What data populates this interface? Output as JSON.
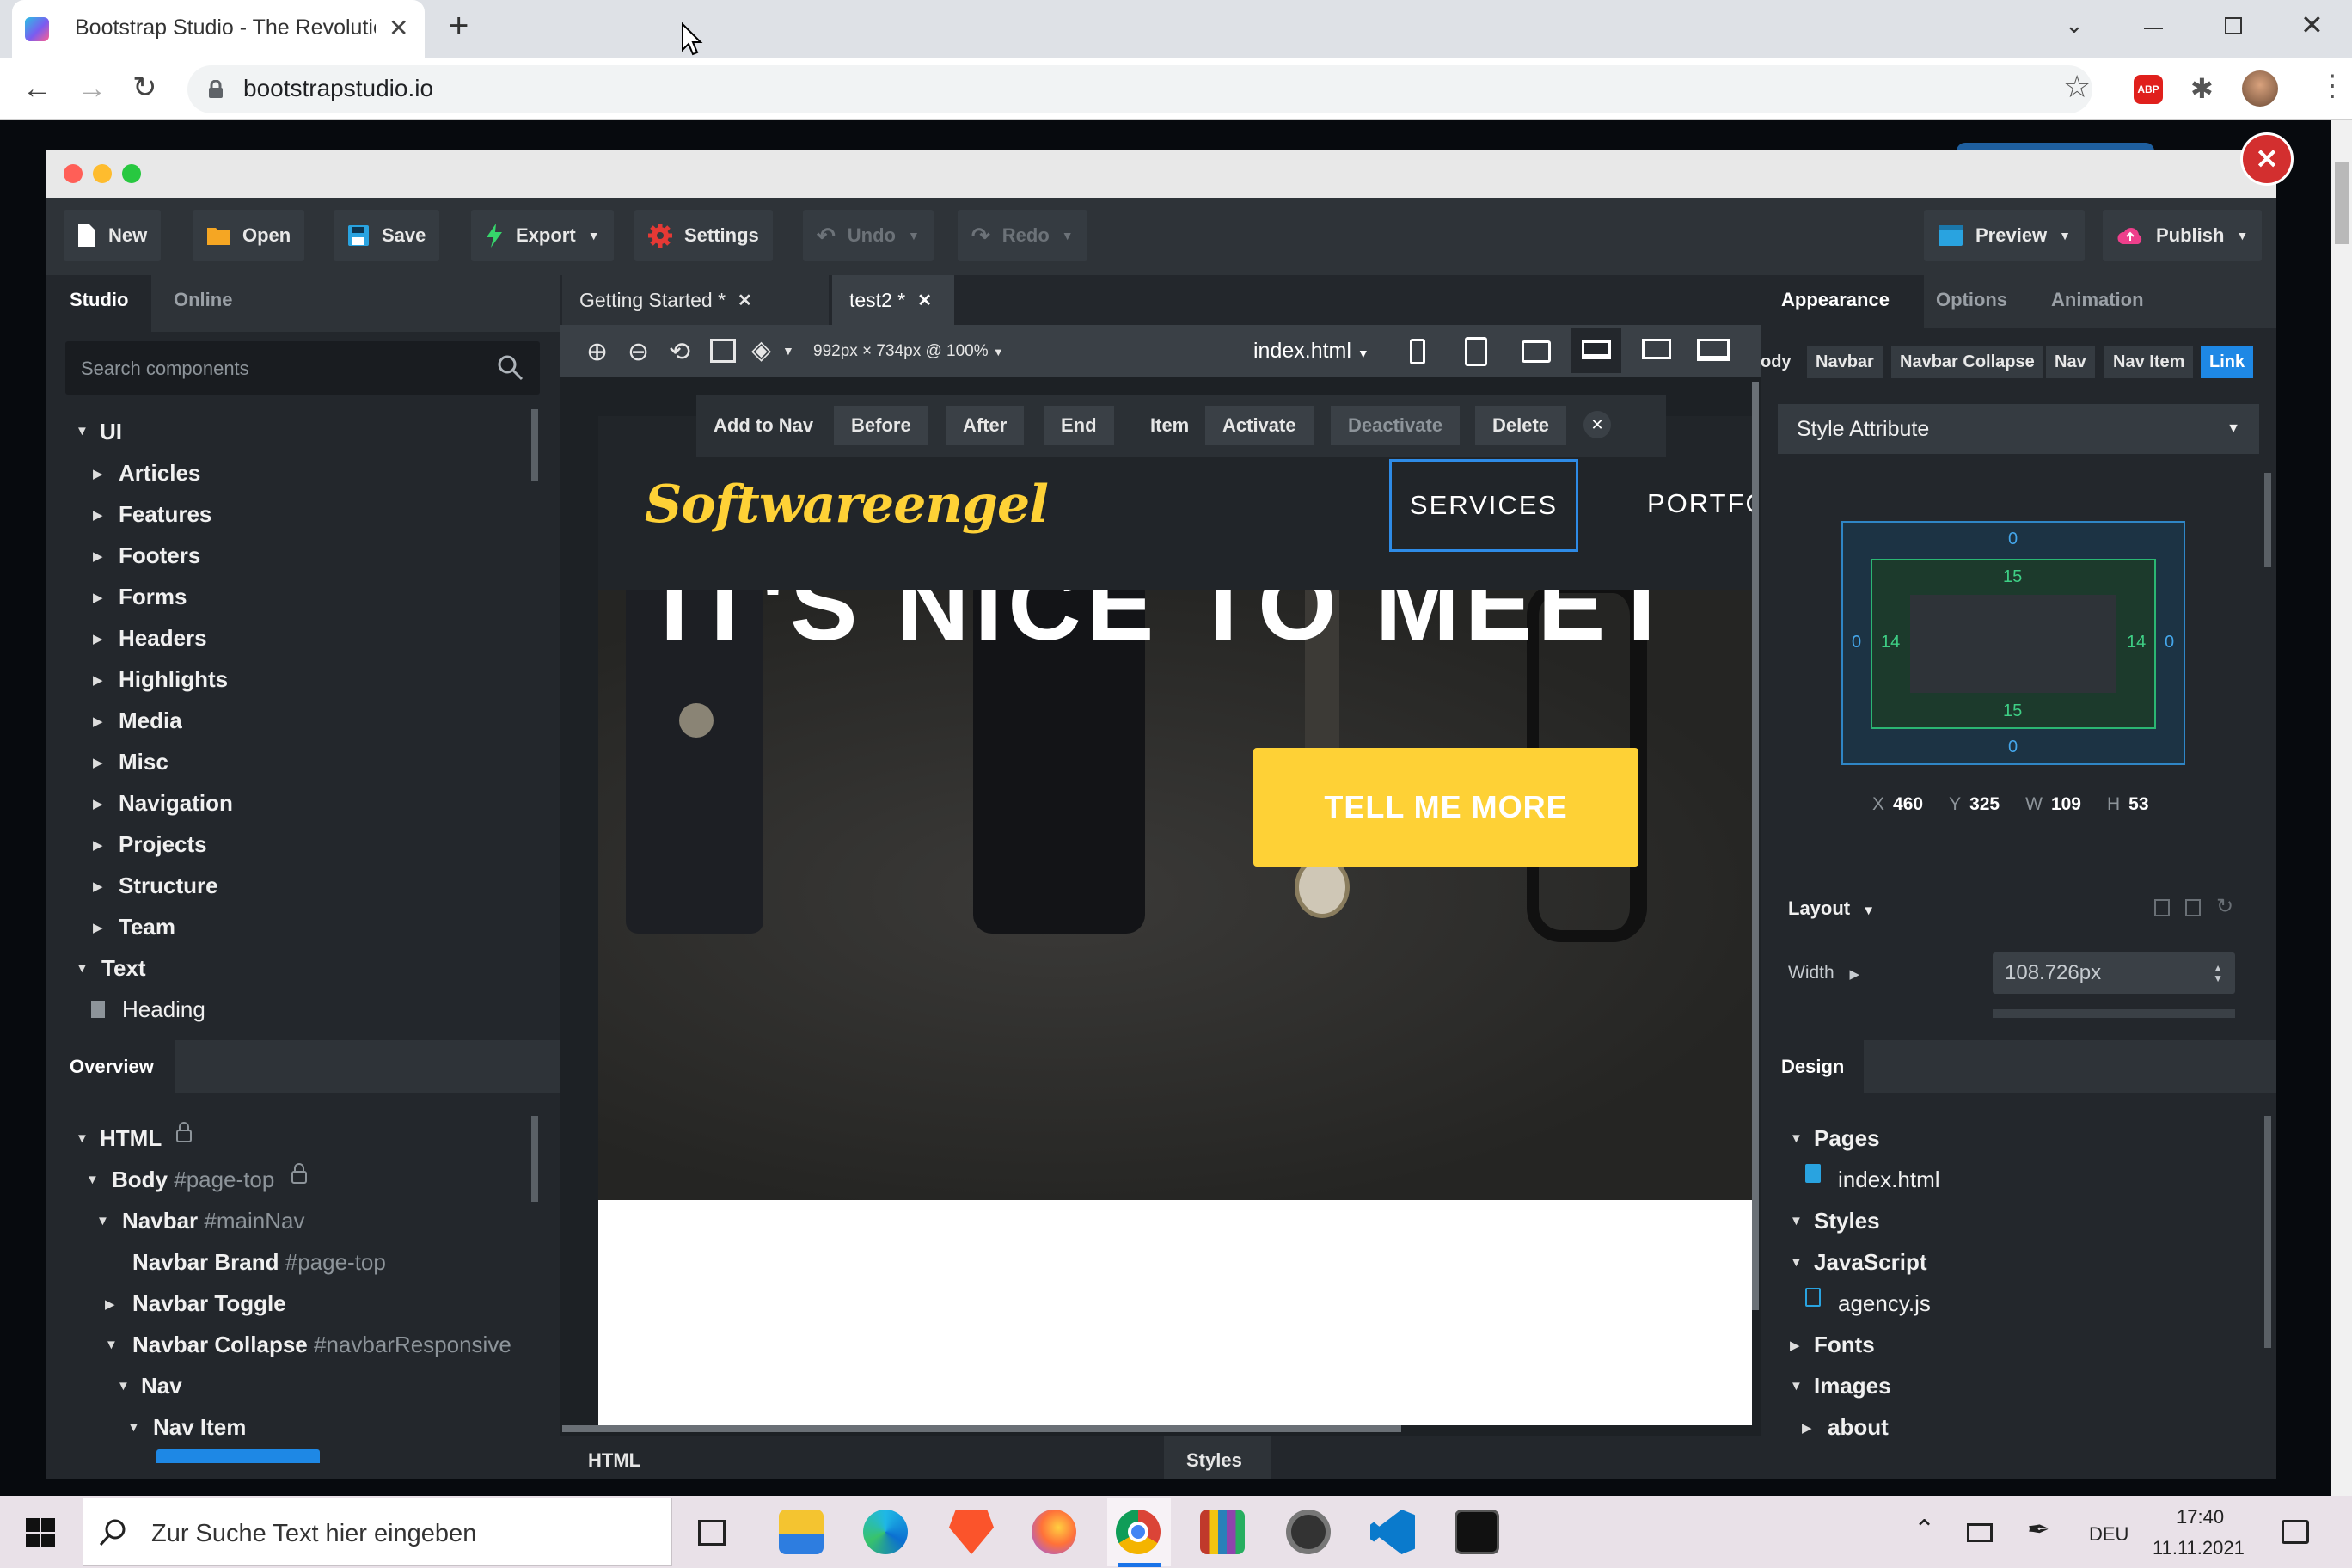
{
  "browser": {
    "tab_title": "Bootstrap Studio - The Revolutio",
    "url": "bootstrapstudio.io",
    "abp_label": "ABP"
  },
  "app": {
    "toolbar": {
      "new": "New",
      "open": "Open",
      "save": "Save",
      "export": "Export",
      "settings": "Settings",
      "undo": "Undo",
      "redo": "Redo",
      "preview": "Preview",
      "publish": "Publish"
    },
    "left": {
      "tabs": [
        "Studio",
        "Online"
      ],
      "search_placeholder": "Search components",
      "ui_root": "UI",
      "ui_items": [
        "Articles",
        "Features",
        "Footers",
        "Forms",
        "Headers",
        "Highlights",
        "Media",
        "Misc",
        "Navigation",
        "Projects",
        "Structure",
        "Team"
      ],
      "text_root": "Text",
      "text_child": "Heading",
      "overview_tab": "Overview",
      "overview": [
        {
          "label": "HTML",
          "id": ""
        },
        {
          "label": "Body",
          "id": "#page-top"
        },
        {
          "label": "Navbar",
          "id": "#mainNav"
        },
        {
          "label": "Navbar Brand",
          "id": "#page-top"
        },
        {
          "label": "Navbar Toggle",
          "id": ""
        },
        {
          "label": "Navbar Collapse",
          "id": "#navbarResponsive"
        },
        {
          "label": "Nav",
          "id": ""
        },
        {
          "label": "Nav Item",
          "id": ""
        }
      ]
    },
    "center": {
      "tabs": [
        "Getting Started *",
        "test2 *"
      ],
      "size_readout": "992px × 734px @ 100%",
      "file": "index.html",
      "context_toolbar": [
        "Add to Nav",
        "Before",
        "After",
        "End",
        "Item",
        "Activate",
        "Deactivate",
        "Delete"
      ],
      "brand": "Softwareengel",
      "nav_links": [
        "SERVICES",
        "PORTFOLIO"
      ],
      "hero_heading": "IT'S NICE TO MEET",
      "hero_button": "TELL ME MORE",
      "bottom_tabs": [
        "HTML",
        "Styles"
      ]
    },
    "right": {
      "tabs": [
        "Appearance",
        "Options",
        "Animation"
      ],
      "breadcrumb": [
        "ody",
        "Navbar",
        "Navbar Collapse",
        "Nav",
        "Nav Item",
        "Link"
      ],
      "style_select": "Style Attribute",
      "box_model": {
        "margin_top": "0",
        "margin_right": "0",
        "margin_bottom": "0",
        "margin_left": "0",
        "padding_top": "15",
        "padding_right": "14",
        "padding_bottom": "15",
        "padding_left": "14"
      },
      "metrics": {
        "x_label": "X",
        "x": "460",
        "y_label": "Y",
        "y": "325",
        "w_label": "W",
        "w": "109",
        "h_label": "H",
        "h": "53"
      },
      "layout_label": "Layout",
      "width_label": "Width",
      "width_value": "108.726px",
      "design_tab": "Design",
      "design_tree": [
        {
          "label": "Pages",
          "kind": "folder"
        },
        {
          "label": "index.html",
          "kind": "file"
        },
        {
          "label": "Styles",
          "kind": "folder"
        },
        {
          "label": "JavaScript",
          "kind": "folder"
        },
        {
          "label": "agency.js",
          "kind": "file"
        },
        {
          "label": "Fonts",
          "kind": "folder"
        },
        {
          "label": "Images",
          "kind": "folder"
        },
        {
          "label": "about",
          "kind": "subfolder"
        }
      ]
    }
  },
  "taskbar": {
    "search_placeholder": "Zur Suche Text hier eingeben",
    "lang": "DEU",
    "time": "17:40",
    "date": "11.11.2021"
  },
  "colors": {
    "accent": "#1e88e5",
    "yellow": "#fed136",
    "close_red": "#d32f2f"
  }
}
